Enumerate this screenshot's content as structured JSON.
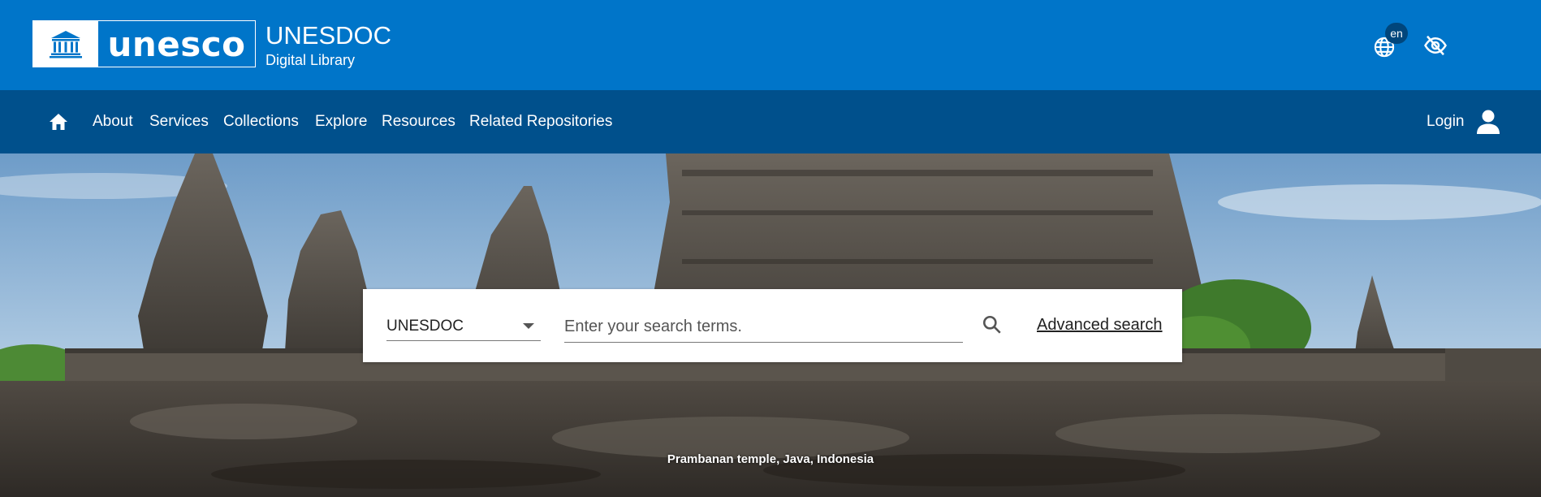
{
  "header": {
    "logo_word": "unesco",
    "title": "UNESDOC",
    "subtitle": "Digital Library",
    "language_badge": "en",
    "icons": {
      "language": "globe-icon",
      "accessibility": "eye-off-icon",
      "logo": "unesco-temple-icon"
    },
    "colors": {
      "topbar": "#0075c9",
      "navbar": "#00508c"
    }
  },
  "nav": {
    "home_icon": "home-icon",
    "items": [
      {
        "label": "About"
      },
      {
        "label": "Services"
      },
      {
        "label": "Collections"
      },
      {
        "label": "Explore"
      },
      {
        "label": "Resources"
      },
      {
        "label": "Related Repositories"
      }
    ],
    "login_label": "Login",
    "login_icon": "user-icon"
  },
  "search": {
    "collection_selected": "UNESDOC",
    "placeholder": "Enter your search terms.",
    "search_icon": "search-icon",
    "advanced_label": "Advanced search"
  },
  "hero": {
    "caption": "Prambanan temple, Java, Indonesia"
  }
}
